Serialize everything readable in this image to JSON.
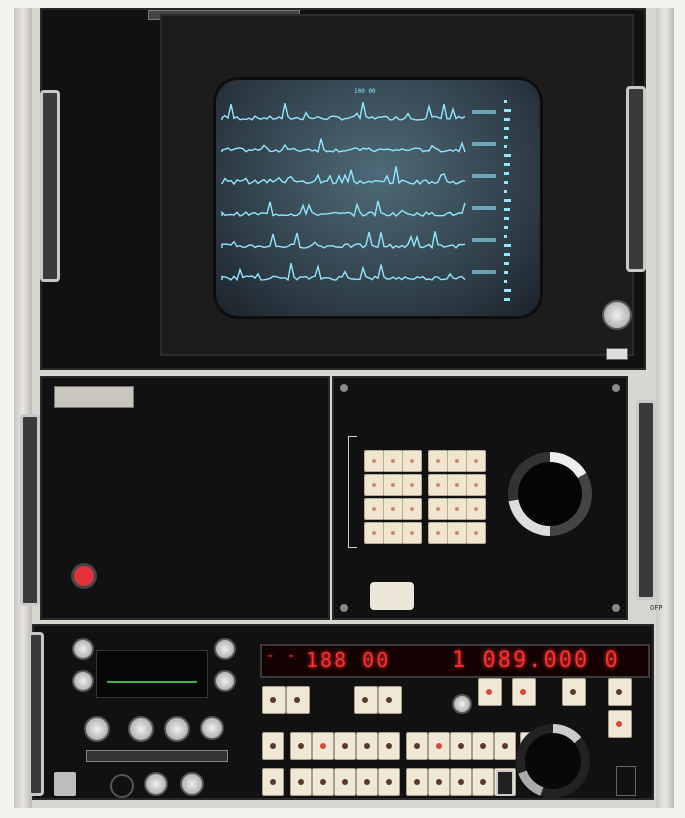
{
  "display_unit": {
    "screen_header": "100 00",
    "trace_count": 6
  },
  "keypad_unit": {
    "key_grid": {
      "left_block": {
        "rows": 4,
        "cols": 3
      },
      "right_block": {
        "rows": 4,
        "cols": 3
      }
    },
    "tuning_knob_icon": "tuning-knob-icon"
  },
  "receiver_unit": {
    "left_display": {
      "prefix": "- -",
      "value": "188 00"
    },
    "right_display": {
      "value": "1 089.000 0"
    },
    "side_tag": "OFP"
  },
  "colors": {
    "panel": "#121111",
    "crt_trace": "#8fe6ff",
    "led": "#ff2d2d",
    "key": "#efe6cf",
    "power_button": "#e2323a"
  }
}
